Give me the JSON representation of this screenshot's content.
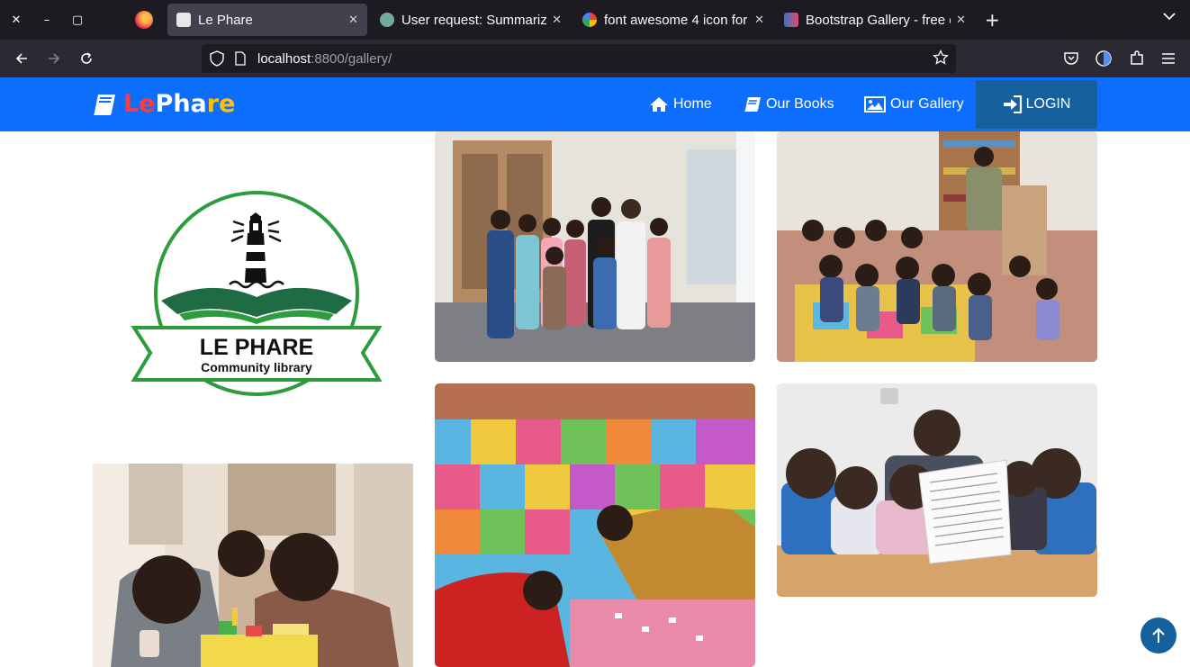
{
  "browser": {
    "tabs": [
      {
        "title": "Le Phare",
        "active": true
      },
      {
        "title": "User request: Summarize",
        "active": false
      },
      {
        "title": "font awesome 4 icon for",
        "active": false
      },
      {
        "title": "Bootstrap Gallery - free e",
        "active": false
      }
    ],
    "url_host": "localhost",
    "url_rest": ":8800/gallery/"
  },
  "site": {
    "brand": {
      "part1": "Le",
      "part2": "Pha",
      "part3": "re"
    },
    "nav": {
      "home": "Home",
      "books": "Our Books",
      "gallery": "Our Gallery",
      "login": "LOGIN"
    },
    "logo": {
      "title": "LE PHARE",
      "subtitle": "Community library"
    }
  },
  "colors": {
    "header_bg": "#0d6efd",
    "login_bg": "#17609e",
    "brand_red": "#ff3b3b",
    "brand_yellow": "#ffc107",
    "logo_green": "#2e9b3c"
  }
}
